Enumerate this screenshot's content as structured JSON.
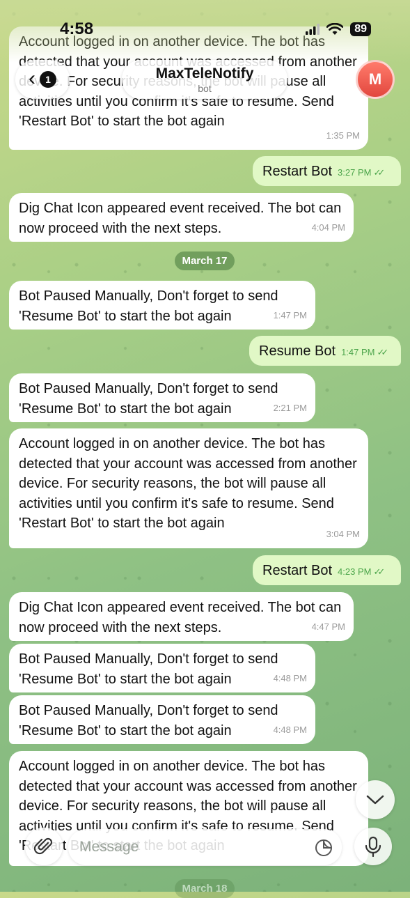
{
  "status_bar": {
    "time": "4:58",
    "battery": "89"
  },
  "header": {
    "unread_count": "1",
    "title": "MaxTeleNotify",
    "subtitle": "bot",
    "avatar_letter": "M"
  },
  "messages": [
    {
      "direction": "in",
      "text": "Account logged in on another device. The bot has detected that your account was accessed from another device. For security reasons, the bot will pause all activities until you confirm it's safe to resume. Send 'Restart Bot' to start the bot again",
      "time": "1:35 PM"
    },
    {
      "direction": "out",
      "text": "Restart Bot",
      "time": "3:27 PM"
    },
    {
      "direction": "in",
      "text": "Dig Chat Icon appeared event received. The bot can now proceed with the next steps.",
      "time": "4:04 PM"
    },
    {
      "direction": "in",
      "text": "Bot Paused Manually, Don't forget to send 'Resume Bot' to start the bot again",
      "time": "1:47 PM"
    },
    {
      "direction": "out",
      "text": "Resume Bot",
      "time": "1:47 PM"
    },
    {
      "direction": "in",
      "text": "Bot Paused Manually, Don't forget to send 'Resume Bot' to start the bot again",
      "time": "2:21 PM"
    },
    {
      "direction": "in",
      "text": "Account logged in on another device. The bot has detected that your account was accessed from another device. For security reasons, the bot will pause all activities until you confirm it's safe to resume. Send 'Restart Bot' to start the bot again",
      "time": "3:04 PM"
    },
    {
      "direction": "out",
      "text": "Restart Bot",
      "time": "4:23 PM"
    },
    {
      "direction": "in",
      "text": "Dig Chat Icon appeared event received. The bot can now proceed with the next steps.",
      "time": "4:47 PM"
    },
    {
      "direction": "in",
      "text": "Bot Paused Manually, Don't forget to send 'Resume Bot' to start the bot again",
      "time": "4:48 PM"
    },
    {
      "direction": "in",
      "text": "Bot Paused Manually, Don't forget to send 'Resume Bot' to start the bot again",
      "time": "4:48 PM"
    },
    {
      "direction": "in",
      "text": "Account logged in on another device. The bot has detected that your account was accessed from another device. For security reasons, the bot will pause all activities until you confirm it's safe to resume. Send 'Restart Bot' to start the bot again",
      "time": ""
    }
  ],
  "date_separators": [
    "March 17",
    "March 18"
  ],
  "composer": {
    "placeholder": "Message"
  },
  "icons": {
    "back": "chevron-left-icon",
    "scroll": "chevron-down-icon",
    "attach": "paperclip-icon",
    "sticker": "sticker-icon",
    "mic": "microphone-icon",
    "read": "double-check-icon"
  },
  "colors": {
    "outgoing_bubble": "#e1f8c6",
    "incoming_bubble": "#ffffff",
    "check": "#4ca54b",
    "avatar": "#e2473e"
  }
}
